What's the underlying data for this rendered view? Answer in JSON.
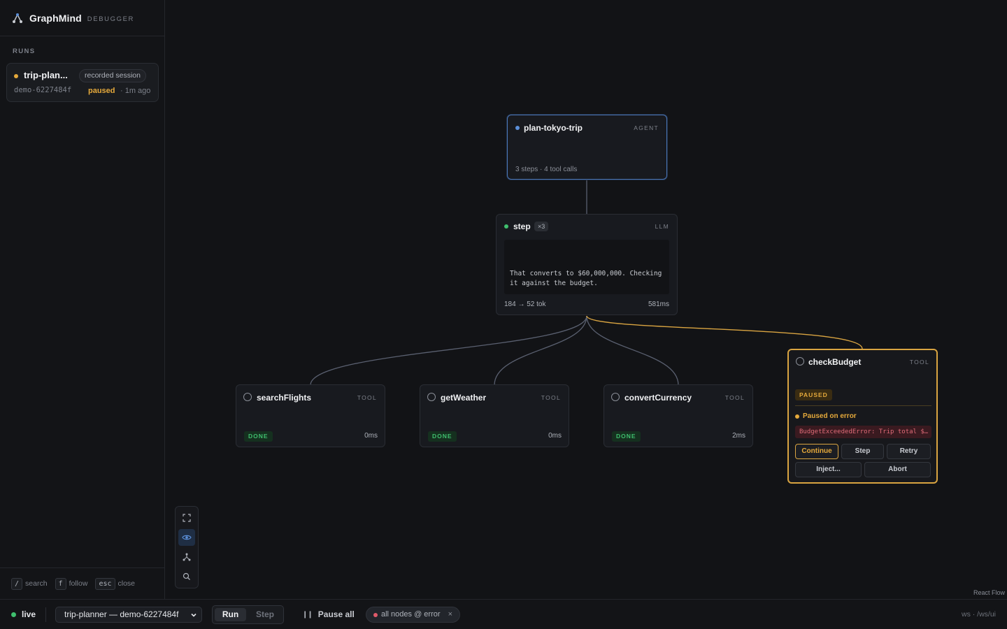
{
  "brand": {
    "name": "GraphMind",
    "sub": "DEBUGGER"
  },
  "sidebar": {
    "heading": "RUNS",
    "runs": [
      {
        "name": "trip-plan...",
        "badge": "recorded session",
        "id": "demo-6227484f",
        "status": "paused",
        "ago": "· 1m ago"
      }
    ],
    "shortcuts": [
      {
        "key": "/",
        "label": "search"
      },
      {
        "key": "f",
        "label": "follow"
      },
      {
        "key": "esc",
        "label": "close"
      }
    ]
  },
  "nodes": {
    "agent": {
      "title": "plan-tokyo-trip",
      "kind": "AGENT",
      "sub": "3 steps · 4 tool calls"
    },
    "step": {
      "title": "step",
      "count": "×3",
      "kind": "LLM",
      "output": "That converts to $60,000,000. Checking it against the budget.",
      "tokens": "184 → 52 tok",
      "ms": "581ms"
    },
    "tools": [
      {
        "title": "searchFlights",
        "kind": "TOOL",
        "status": "DONE",
        "ms": "0ms"
      },
      {
        "title": "getWeather",
        "kind": "TOOL",
        "status": "DONE",
        "ms": "0ms"
      },
      {
        "title": "convertCurrency",
        "kind": "TOOL",
        "status": "DONE",
        "ms": "2ms"
      }
    ],
    "paused": {
      "title": "checkBudget",
      "kind": "TOOL",
      "status": "PAUSED",
      "reason": "Paused on error",
      "error": "BudgetExceededError: Trip total $…",
      "buttons": {
        "continue": "Continue",
        "step": "Step",
        "retry": "Retry",
        "inject": "Inject...",
        "abort": "Abort"
      }
    }
  },
  "attribution": "React Flow",
  "bottombar": {
    "live": "live",
    "run_select": "trip-planner — demo-6227484f",
    "run": "Run",
    "step": "Step",
    "pause_all": "Pause all",
    "breakpoint": "all nodes @ error",
    "breakpoint_close": "×",
    "ws": "ws · /ws/ui"
  },
  "colors": {
    "accent_blue": "#4a76b8",
    "paused": "#d9a441",
    "done": "#3fbf6e",
    "error": "#e05a6a"
  }
}
